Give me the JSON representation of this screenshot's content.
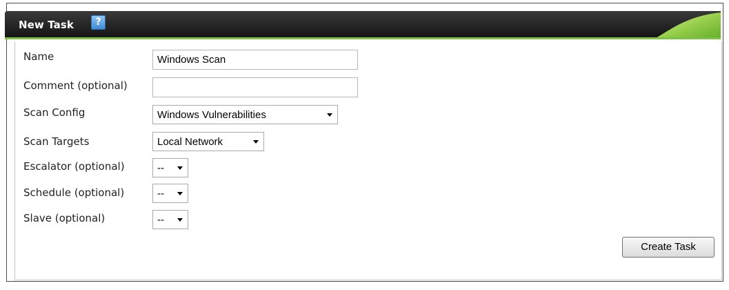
{
  "header": {
    "title": "New Task",
    "help_icon": "?",
    "colors": {
      "bar_dark": "#1a1a1a",
      "accent_green": "#7ec242"
    }
  },
  "form": {
    "name": {
      "label": "Name",
      "value": "Windows Scan"
    },
    "comment": {
      "label": "Comment (optional)",
      "value": ""
    },
    "scan_config": {
      "label": "Scan Config",
      "selected": "Windows Vulnerabilities"
    },
    "scan_targets": {
      "label": "Scan Targets",
      "selected": "Local Network"
    },
    "escalator": {
      "label": "Escalator (optional)",
      "selected": "--"
    },
    "schedule": {
      "label": "Schedule (optional)",
      "selected": "--"
    },
    "slave": {
      "label": "Slave (optional)",
      "selected": "--"
    }
  },
  "actions": {
    "create_label": "Create Task"
  }
}
